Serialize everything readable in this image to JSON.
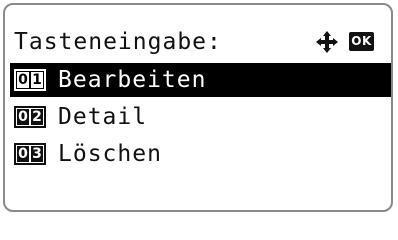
{
  "header": {
    "title": "Tasteneingabe:",
    "nav_icon": "four-way-arrow-icon",
    "ok_key": "OK"
  },
  "menu": {
    "items": [
      {
        "number": "01",
        "label": "Bearbeiten",
        "selected": true
      },
      {
        "number": "02",
        "label": "Detail",
        "selected": false
      },
      {
        "number": "03",
        "label": "Löschen",
        "selected": false
      }
    ]
  },
  "colors": {
    "text": "#111111",
    "selection": "#000000",
    "frame": "#8a8a8a"
  }
}
